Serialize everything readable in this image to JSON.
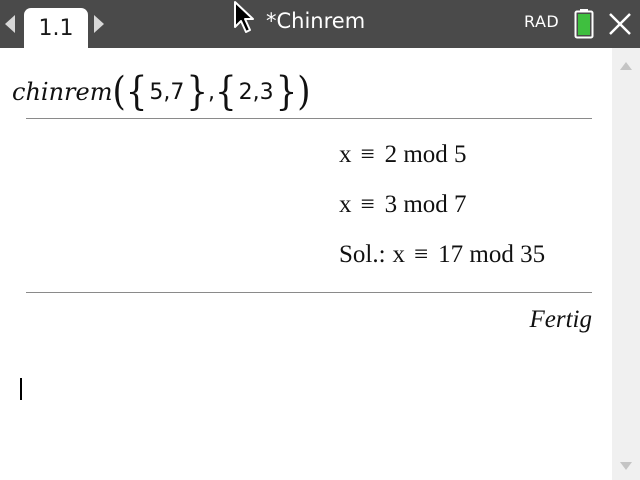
{
  "header": {
    "tab_label": "1.1",
    "document_title": "*Chinrem",
    "angle_mode": "RAD",
    "battery_color": "#3fbf3f",
    "icons": [
      "nav-left-icon",
      "nav-right-icon",
      "mouse-pointer-icon",
      "battery-icon",
      "close-icon"
    ]
  },
  "calculator": {
    "entry": {
      "function_name": "chinrem",
      "list1": "5,7",
      "list2": "2,3",
      "separator": ","
    },
    "output_lines": [
      {
        "var": "x",
        "symbol": "≡",
        "value": "2 mod 5"
      },
      {
        "var": "x",
        "symbol": "≡",
        "value": "3 mod 7"
      },
      {
        "prefix": "Sol.:",
        "var": "x",
        "symbol": "≡",
        "value": "17 mod 35"
      }
    ],
    "status": "Fertig"
  }
}
